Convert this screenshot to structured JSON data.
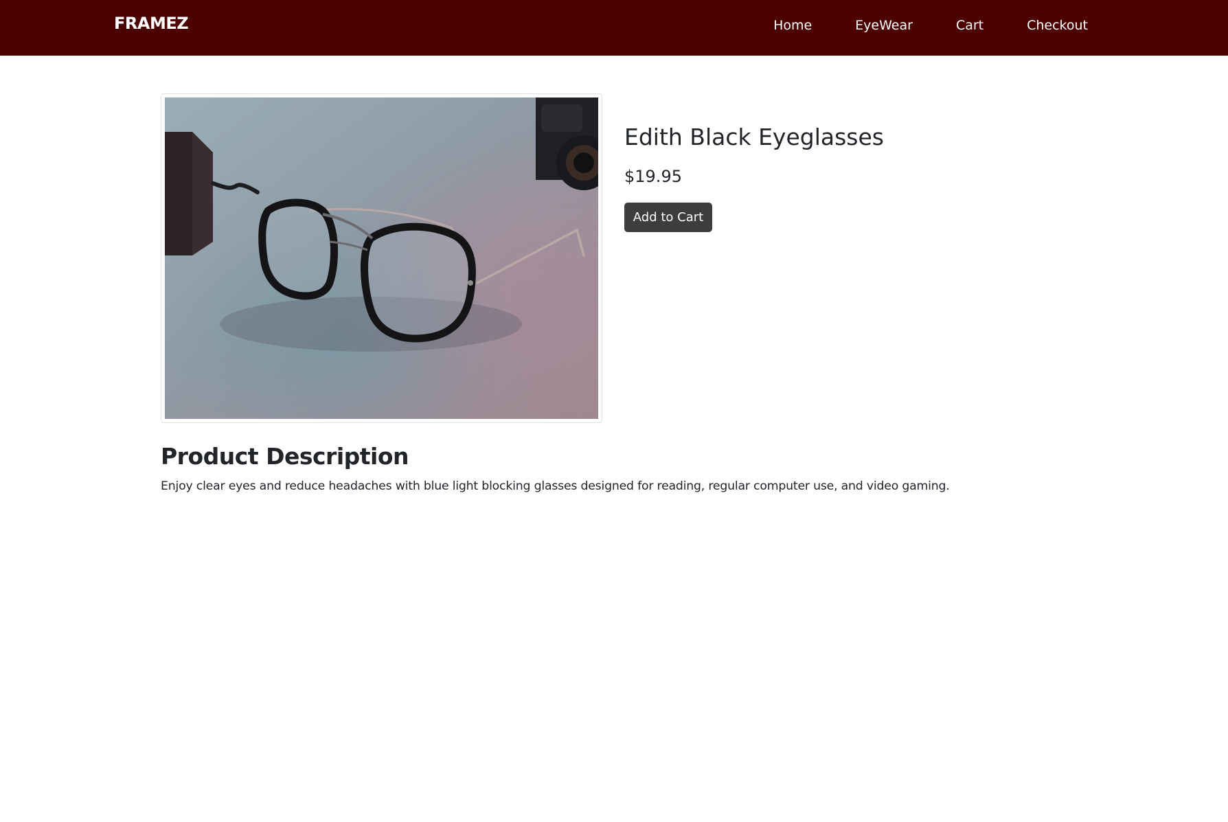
{
  "navbar": {
    "brand": "FRAMEZ",
    "links": [
      {
        "label": "Home"
      },
      {
        "label": "EyeWear"
      },
      {
        "label": "Cart"
      },
      {
        "label": "Checkout"
      }
    ],
    "background_color": "#4d0000"
  },
  "product": {
    "title": "Edith Black Eyeglasses",
    "price": "$19.95",
    "add_to_cart_label": "Add to Cart",
    "image_icon": "eyeglasses-photo"
  },
  "description": {
    "heading": "Product Description",
    "text": "Enjoy clear eyes and reduce headaches with blue light blocking glasses designed for reading, regular computer use, and video gaming."
  }
}
